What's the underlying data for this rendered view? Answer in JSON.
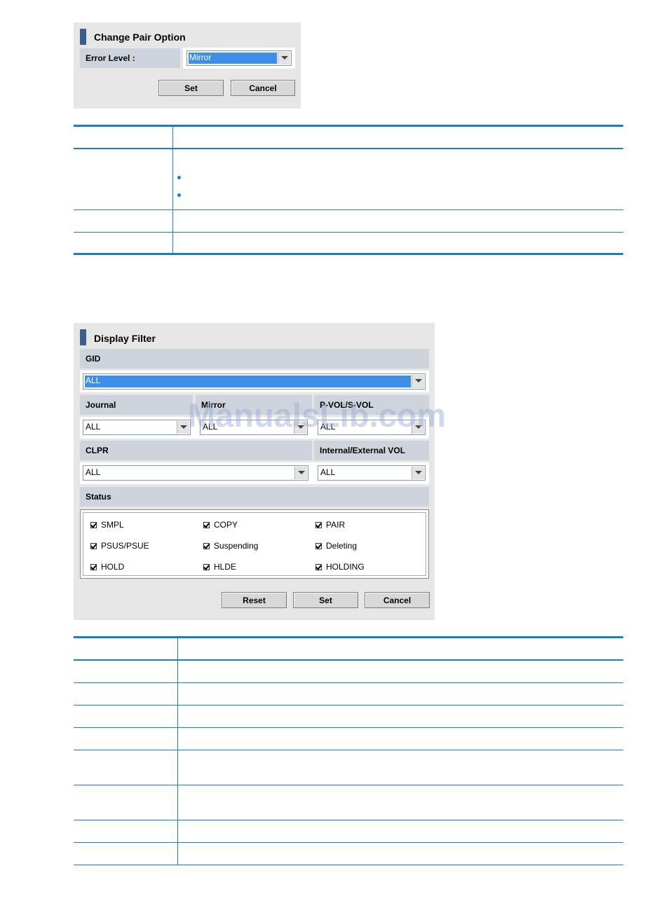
{
  "change_pair_option": {
    "title": "Change Pair Option",
    "error_level_label": "Error Level :",
    "error_level_value": "Mirror",
    "set_label": "Set",
    "cancel_label": "Cancel"
  },
  "display_filter": {
    "title": "Display Filter",
    "gid_label": "GID",
    "gid_value": "ALL",
    "journal_label": "Journal",
    "journal_value": "ALL",
    "mirror_label": "Mirror",
    "mirror_value": "ALL",
    "pvol_svol_label": "P-VOL/S-VOL",
    "pvol_svol_value": "ALL",
    "clpr_label": "CLPR",
    "clpr_value": "ALL",
    "int_ext_label": "Internal/External VOL",
    "int_ext_value": "ALL",
    "status_label": "Status",
    "statuses": [
      "SMPL",
      "COPY",
      "PAIR",
      "PSUS/PSUE",
      "Suspending",
      "Deleting",
      "HOLD",
      "HLDE",
      "HOLDING"
    ],
    "reset_label": "Reset",
    "set_label": "Set",
    "cancel_label": "Cancel"
  },
  "watermark": "ManualsLib.com"
}
